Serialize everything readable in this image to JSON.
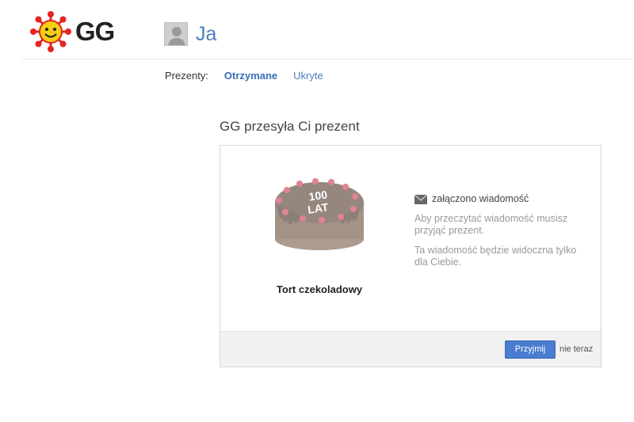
{
  "brand": {
    "name": "GG",
    "icon": "gg-sun-logo-icon"
  },
  "user": {
    "name": "Ja",
    "avatar_icon": "user-avatar-icon"
  },
  "tabs": {
    "label": "Prezenty:",
    "items": [
      {
        "label": "Otrzymane",
        "active": true
      },
      {
        "label": "Ukryte",
        "active": false
      }
    ]
  },
  "gift": {
    "title": "GG przesyła Ci prezent",
    "cake_text": "100 LAT",
    "name": "Tort czekoladowy",
    "message": {
      "heading": "załączono wiadomość",
      "line1": "Aby przeczytać wiadomość musisz przyjąć prezent.",
      "line2": "Ta wiadomość będzie widoczna tylko dla Ciebie."
    },
    "accept_label": "Przyjmij",
    "later_label": "nie teraz"
  },
  "colors": {
    "accent": "#4a7dd0",
    "link": "#4d7ebf"
  }
}
